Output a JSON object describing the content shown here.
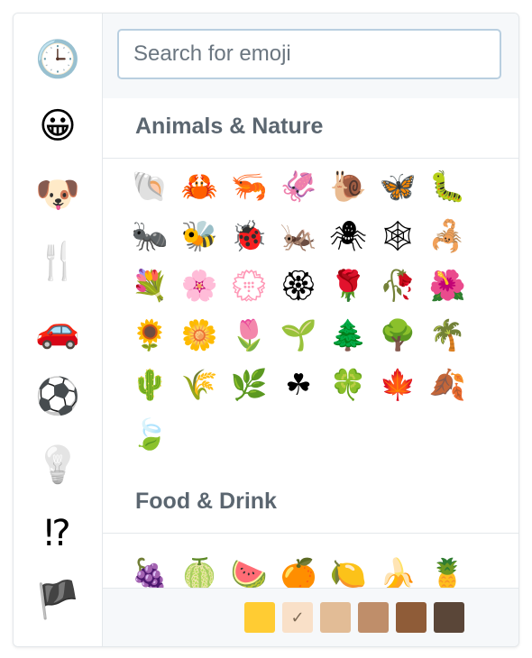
{
  "sidebar": {
    "categories": [
      {
        "name": "recent",
        "icon": "clock-icon",
        "glyph": "🕒"
      },
      {
        "name": "smileys",
        "icon": "grinning-face-icon",
        "glyph": "😀"
      },
      {
        "name": "animals",
        "icon": "dog-face-icon",
        "glyph": "🐶"
      },
      {
        "name": "food",
        "icon": "fork-knife-icon",
        "glyph": "🍴"
      },
      {
        "name": "travel",
        "icon": "car-icon",
        "glyph": "🚗"
      },
      {
        "name": "activity",
        "icon": "soccer-ball-icon",
        "glyph": "⚽"
      },
      {
        "name": "objects",
        "icon": "light-bulb-icon",
        "glyph": "💡"
      },
      {
        "name": "symbols",
        "icon": "exclamation-question-icon",
        "glyph": "⁉"
      },
      {
        "name": "flags",
        "icon": "black-flag-icon",
        "glyph": "🏴"
      }
    ]
  },
  "search": {
    "value": "",
    "placeholder": "Search for emoji"
  },
  "sections": [
    {
      "title": "Animals & Nature",
      "emojis": [
        "🐚",
        "🦀",
        "🦐",
        "🦑",
        "🐌",
        "🦋",
        "🐛",
        "🐜",
        "🐝",
        "🐞",
        "🦗",
        "🕷",
        "🕸",
        "🦂",
        "💐",
        "🌸",
        "💮",
        "🏵",
        "🌹",
        "🥀",
        "🌺",
        "🌻",
        "🌼",
        "🌷",
        "🌱",
        "🌲",
        "🌳",
        "🌴",
        "🌵",
        "🌾",
        "🌿",
        "☘",
        "🍀",
        "🍁",
        "🍂",
        "🍃"
      ]
    },
    {
      "title": "Food & Drink",
      "emojis": [
        "🍇",
        "🍈",
        "🍉",
        "🍊",
        "🍋",
        "🍌",
        "🍍"
      ]
    }
  ],
  "skin_tones": {
    "selected_index": 1,
    "check_glyph": "✓",
    "colors": [
      "#ffcc33",
      "#f9e0c8",
      "#e2bc96",
      "#bf8e6a",
      "#8f5c38",
      "#5a4638"
    ]
  }
}
